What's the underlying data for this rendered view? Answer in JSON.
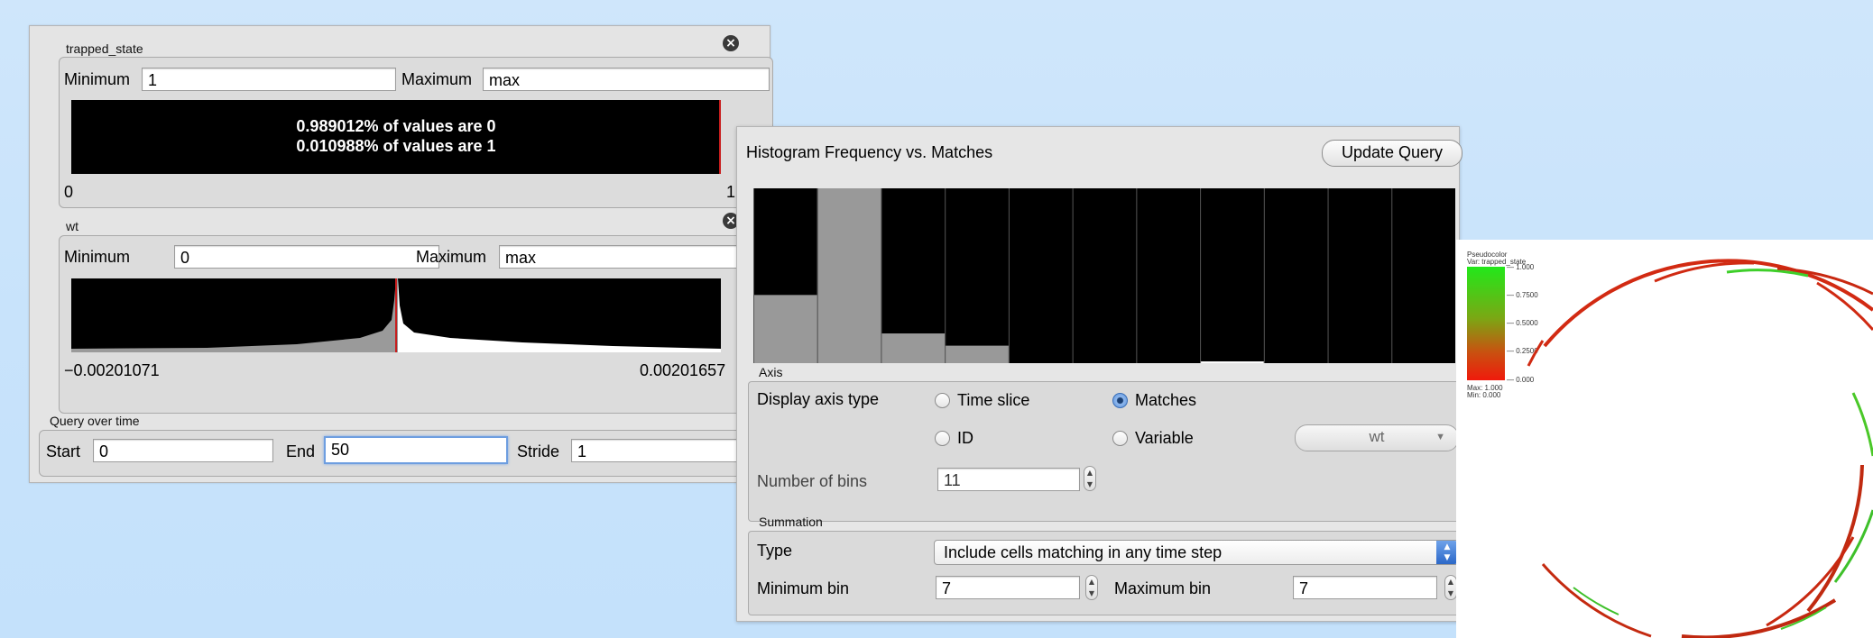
{
  "trapped_state": {
    "title": "trapped_state",
    "min_label": "Minimum",
    "min_value": "1",
    "max_label": "Maximum",
    "max_value": "max",
    "msg_line1": "0.989012% of values are 0",
    "msg_line2": "0.010988% of values are 1",
    "range_low": "0",
    "range_high": "1"
  },
  "wt": {
    "title": "wt",
    "min_label": "Minimum",
    "min_value": "0",
    "max_label": "Maximum",
    "max_value": "max",
    "range_low": "−0.00201071",
    "range_high": "0.00201657"
  },
  "query_over_time": {
    "title": "Query over time",
    "start_label": "Start",
    "start_value": "0",
    "end_label": "End",
    "end_value": "50",
    "stride_label": "Stride",
    "stride_value": "1"
  },
  "histogram_panel": {
    "title": "Histogram  Frequency vs. Matches",
    "update_button": "Update Query",
    "axis_section": "Axis",
    "display_axis_type_label": "Display axis type",
    "radio_time_slice": "Time slice",
    "radio_matches": "Matches",
    "radio_id": "ID",
    "radio_variable": "Variable",
    "variable_select": "wt",
    "selected_axis_type": "Matches",
    "number_of_bins_label": "Number of bins",
    "number_of_bins_value": "11",
    "summation_section": "Summation",
    "type_label": "Type",
    "type_value": "Include cells matching in any time step",
    "min_bin_label": "Minimum bin",
    "min_bin_value": "7",
    "max_bin_label": "Maximum bin",
    "max_bin_value": "7",
    "bin_heights": [
      0.39,
      1.0,
      0.17,
      0.1,
      0.0,
      0.0,
      0.0,
      0.01,
      0.0,
      0.0,
      0.0
    ],
    "highlighted_bins": [
      0,
      1,
      2,
      3
    ]
  },
  "pseudocolor": {
    "line1": "Pseudocolor",
    "line2": "Var: trapped_state",
    "tick_top": "1.000",
    "tick_2": "0.7500",
    "tick_3": "0.5000",
    "tick_4": "0.2500",
    "tick_bottom": "0.000",
    "max_text": "Max:  1.000",
    "min_text": "Min:  0.000",
    "color_high": "#2ee02e",
    "color_low": "#e82a12"
  },
  "colors": {
    "accent_focus": "#6e9ee0",
    "radio_selected": "#3a6fb8",
    "histogram_bg": "#000000",
    "histogram_bar": "#999999",
    "marker_red": "#c81e1e"
  }
}
